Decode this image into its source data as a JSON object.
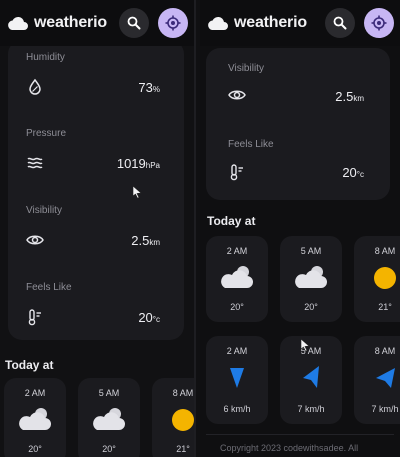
{
  "app": {
    "name": "weatherio"
  },
  "colors": {
    "accent": "#c7b6f4",
    "wind_arrow": "#1e7be5",
    "sun": "#f4b400"
  },
  "left": {
    "highlights": [
      {
        "label": "Humidity",
        "icon": "humidity-drop-icon",
        "value": "73",
        "unit": "%"
      },
      {
        "label": "Pressure",
        "icon": "wave-icon",
        "value": "1019",
        "unit": "hPa"
      },
      {
        "label": "Visibility",
        "icon": "eye-icon",
        "value": "2.5",
        "unit": "km"
      },
      {
        "label": "Feels Like",
        "icon": "thermometer-icon",
        "value": "20",
        "unit": "°c"
      }
    ],
    "today_title": "Today at",
    "hours": [
      {
        "time": "2 AM",
        "icon": "cloud-moon-icon",
        "temp": "20°"
      },
      {
        "time": "5 AM",
        "icon": "cloud-moon-icon",
        "temp": "20°"
      },
      {
        "time": "8 AM",
        "icon": "sun-icon",
        "temp": "21°"
      }
    ]
  },
  "right": {
    "highlights": [
      {
        "label": "Visibility",
        "icon": "eye-icon",
        "value": "2.5",
        "unit": "km"
      },
      {
        "label": "Feels Like",
        "icon": "thermometer-icon",
        "value": "20",
        "unit": "°c"
      }
    ],
    "today_title": "Today at",
    "hours": [
      {
        "time": "2 AM",
        "icon": "cloud-moon-icon",
        "temp": "20°"
      },
      {
        "time": "5 AM",
        "icon": "cloud-moon-icon",
        "temp": "20°"
      },
      {
        "time": "8 AM",
        "icon": "sun-icon",
        "temp": "21°"
      }
    ],
    "wind": [
      {
        "time": "2 AM",
        "icon": "wind-direction-icon",
        "speed": "6 km/h"
      },
      {
        "time": "5 AM",
        "icon": "wind-direction-icon",
        "speed": "7 km/h"
      },
      {
        "time": "8 AM",
        "icon": "wind-direction-icon",
        "speed": "7 km/h"
      }
    ],
    "footer": "Copyright 2023 codewithsadee. All"
  }
}
